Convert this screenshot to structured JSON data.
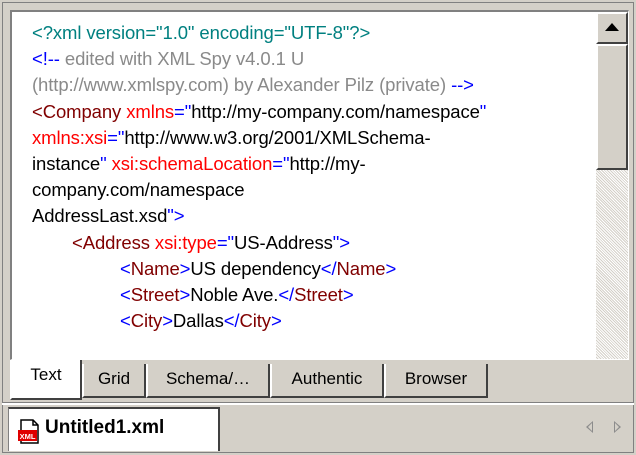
{
  "editor": {
    "lines": [
      [
        {
          "t": "<?xml version=\"1.0\" encoding=\"UTF-8\"?>",
          "c": "teal"
        }
      ],
      [
        {
          "t": "<!--",
          "c": "blue"
        },
        {
          "t": " edited with XML Spy v4.0.1 U",
          "c": "gray"
        }
      ],
      [
        {
          "t": "(http://www.xmlspy.com) by Alexander Pilz (private) ",
          "c": "gray"
        },
        {
          "t": "-->",
          "c": "blue"
        }
      ],
      [
        {
          "t": "<Company ",
          "c": "mar"
        },
        {
          "t": "xmlns",
          "c": "red"
        },
        {
          "t": "=\"",
          "c": "blue"
        },
        {
          "t": "http://my-company.com/namespace",
          "c": "blk"
        },
        {
          "t": "\"",
          "c": "blue"
        }
      ],
      [
        {
          "t": "xmlns:xsi",
          "c": "red"
        },
        {
          "t": "=\"",
          "c": "blue"
        },
        {
          "t": "http://www.w3.org/2001/XMLSchema-",
          "c": "blk"
        }
      ],
      [
        {
          "t": "instance",
          "c": "blk"
        },
        {
          "t": "\" ",
          "c": "blue"
        },
        {
          "t": "xsi:schemaLocation",
          "c": "red"
        },
        {
          "t": "=\"",
          "c": "blue"
        },
        {
          "t": "http://my-",
          "c": "blk"
        }
      ],
      [
        {
          "t": "company.com/namespace",
          "c": "blk"
        }
      ],
      [
        {
          "t": "AddressLast.xsd",
          "c": "blk"
        },
        {
          "t": "\">",
          "c": "blue"
        }
      ],
      [
        {
          "t": "<Address ",
          "c": "mar",
          "ind": 1
        },
        {
          "t": "xsi:type",
          "c": "red"
        },
        {
          "t": "=\"",
          "c": "blue"
        },
        {
          "t": "US-Address",
          "c": "blk"
        },
        {
          "t": "\">",
          "c": "blue"
        }
      ],
      [
        {
          "t": "<",
          "c": "blue",
          "ind": 2
        },
        {
          "t": "Name",
          "c": "mar"
        },
        {
          "t": ">",
          "c": "blue"
        },
        {
          "t": "US dependency",
          "c": "blk"
        },
        {
          "t": "</",
          "c": "blue"
        },
        {
          "t": "Name",
          "c": "mar"
        },
        {
          "t": ">",
          "c": "blue"
        }
      ],
      [
        {
          "t": "<",
          "c": "blue",
          "ind": 2
        },
        {
          "t": "Street",
          "c": "mar"
        },
        {
          "t": ">",
          "c": "blue"
        },
        {
          "t": "Noble Ave.",
          "c": "blk"
        },
        {
          "t": "</",
          "c": "blue"
        },
        {
          "t": "Street",
          "c": "mar"
        },
        {
          "t": ">",
          "c": "blue"
        }
      ],
      [
        {
          "t": "<",
          "c": "blue",
          "ind": 2
        },
        {
          "t": "City",
          "c": "mar"
        },
        {
          "t": ">",
          "c": "blue"
        },
        {
          "t": "Dallas",
          "c": "blk"
        },
        {
          "t": "</",
          "c": "blue"
        },
        {
          "t": "City",
          "c": "mar"
        },
        {
          "t": ">",
          "c": "blue"
        }
      ]
    ]
  },
  "view_tabs": [
    {
      "label": "Text",
      "active": true
    },
    {
      "label": "Grid",
      "active": false
    },
    {
      "label": "Schema/…",
      "active": false
    },
    {
      "label": "Authentic",
      "active": false
    },
    {
      "label": "Browser",
      "active": false
    }
  ],
  "document_tab": {
    "filename": "Untitled1.xml",
    "icon": "xml-file-icon",
    "icon_text": "XML"
  },
  "scroll": {
    "up_icon": "arrow-up-icon",
    "prev_icon": "tab-prev-icon",
    "next_icon": "tab-next-icon"
  },
  "colors": {
    "teal": "#008080",
    "gray": "#8a8a8a",
    "blue": "#0000ff",
    "red": "#ff0000",
    "maroon": "#800000",
    "chrome": "#d4d0c8"
  }
}
